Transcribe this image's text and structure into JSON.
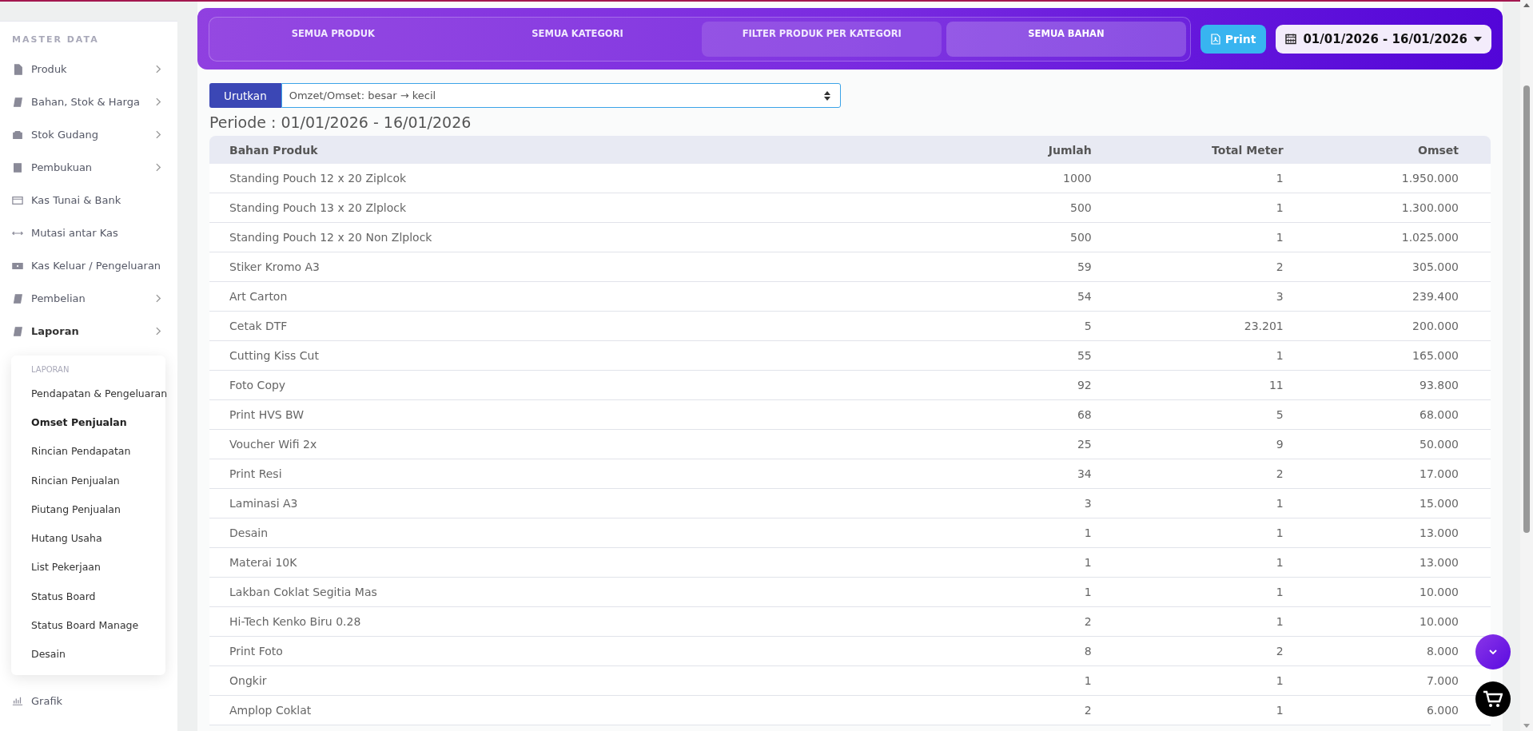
{
  "sidebar": {
    "section": "MASTER DATA",
    "items": [
      {
        "label": "Produk",
        "arrow": true,
        "bold": false
      },
      {
        "label": "Bahan, Stok & Harga",
        "arrow": true,
        "bold": false
      },
      {
        "label": "Stok Gudang",
        "arrow": true,
        "bold": false
      },
      {
        "label": "Pembukuan",
        "arrow": true,
        "bold": false
      },
      {
        "label": "Kas Tunai & Bank",
        "arrow": false,
        "bold": false
      },
      {
        "label": "Mutasi antar Kas",
        "arrow": false,
        "bold": false
      },
      {
        "label": "Kas Keluar / Pengeluaran",
        "arrow": false,
        "bold": false
      },
      {
        "label": "Pembelian",
        "arrow": true,
        "bold": false
      },
      {
        "label": "Laporan",
        "arrow": true,
        "bold": true
      }
    ],
    "submenu": {
      "title": "LAPORAN",
      "items": [
        {
          "label": "Pendapatan & Pengeluaran",
          "selected": false
        },
        {
          "label": "Omset Penjualan",
          "selected": true
        },
        {
          "label": "Rincian Pendapatan",
          "selected": false
        },
        {
          "label": "Rincian Penjualan",
          "selected": false
        },
        {
          "label": "Piutang Penjualan",
          "selected": false
        },
        {
          "label": "Hutang Usaha",
          "selected": false
        },
        {
          "label": "List Pekerjaan",
          "selected": false
        },
        {
          "label": "Status Board",
          "selected": false
        },
        {
          "label": "Status Board Manage",
          "selected": false
        },
        {
          "label": "Desain",
          "selected": false
        }
      ]
    },
    "after": [
      {
        "label": "Grafik"
      }
    ]
  },
  "tabs": [
    {
      "label": "SEMUA PRODUK",
      "selected": false,
      "hovered": false
    },
    {
      "label": "SEMUA KATEGORI",
      "selected": false,
      "hovered": false
    },
    {
      "label": "FILTER PRODUK PER KATEGORI",
      "selected": false,
      "hovered": true
    },
    {
      "label": "SEMUA BAHAN",
      "selected": true,
      "hovered": false
    }
  ],
  "print_button": "Print",
  "date_range": "01/01/2026 - 16/01/2026",
  "sort": {
    "label": "Urutkan",
    "value": "Omzet/Omset: besar → kecil"
  },
  "period": "Periode : 01/01/2026 - 16/01/2026",
  "table": {
    "columns": [
      "Bahan Produk",
      "Jumlah",
      "Total Meter",
      "Omset"
    ],
    "rows": [
      [
        "Standing Pouch 12 x 20 Ziplcok",
        "1000",
        "1",
        "1.950.000"
      ],
      [
        "Standing Pouch 13 x 20 Zlplock",
        "500",
        "1",
        "1.300.000"
      ],
      [
        "Standing Pouch 12 x 20 Non Zlplock",
        "500",
        "1",
        "1.025.000"
      ],
      [
        "Stiker Kromo A3",
        "59",
        "2",
        "305.000"
      ],
      [
        "Art Carton",
        "54",
        "3",
        "239.400"
      ],
      [
        "Cetak DTF",
        "5",
        "23.201",
        "200.000"
      ],
      [
        "Cutting Kiss Cut",
        "55",
        "1",
        "165.000"
      ],
      [
        "Foto Copy",
        "92",
        "11",
        "93.800"
      ],
      [
        "Print HVS BW",
        "68",
        "5",
        "68.000"
      ],
      [
        "Voucher Wifi 2x",
        "25",
        "9",
        "50.000"
      ],
      [
        "Print Resi",
        "34",
        "2",
        "17.000"
      ],
      [
        "Laminasi A3",
        "3",
        "1",
        "15.000"
      ],
      [
        "Desain",
        "1",
        "1",
        "13.000"
      ],
      [
        "Materai 10K",
        "1",
        "1",
        "13.000"
      ],
      [
        "Lakban Coklat Segitia Mas",
        "1",
        "1",
        "10.000"
      ],
      [
        "Hi-Tech Kenko Biru 0.28",
        "2",
        "1",
        "10.000"
      ],
      [
        "Print Foto",
        "8",
        "2",
        "8.000"
      ],
      [
        "Ongkir",
        "1",
        "1",
        "7.000"
      ],
      [
        "Amplop Coklat",
        "2",
        "1",
        "6.000"
      ]
    ]
  }
}
